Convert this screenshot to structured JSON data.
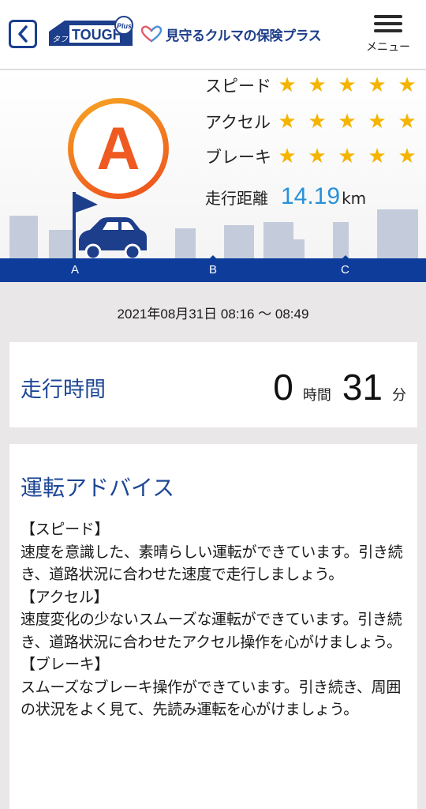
{
  "header": {
    "back_icon": "chevron-left-icon",
    "logo_small": "タフ",
    "logo_text": "TOUGH",
    "logo_badge": "Plus",
    "tagline": "見守るクルマの保険プラス",
    "menu_label": "メニュー"
  },
  "score": {
    "grade": "A",
    "ratings": [
      {
        "label": "スピード",
        "stars": 5
      },
      {
        "label": "アクセル",
        "stars": 5
      },
      {
        "label": "ブレーキ",
        "stars": 5
      }
    ],
    "distance_label": "走行距離",
    "distance_value": "14.19",
    "distance_unit": "km",
    "road_labels": [
      "A",
      "B",
      "C"
    ]
  },
  "trip": {
    "datetime": "2021年08月31日 08:16 〜 08:49"
  },
  "drive_time": {
    "title": "走行時間",
    "hours": "0",
    "hours_unit": "時間",
    "minutes": "31",
    "minutes_unit": "分"
  },
  "advice": {
    "title": "運転アドバイス",
    "sections": [
      {
        "heading": "【スピード】",
        "text": "速度を意識した、素晴らしい運転ができています。引き続き、道路状況に合わせた速度で走行しましょう。"
      },
      {
        "heading": "【アクセル】",
        "text": "速度変化の少ないスムーズな運転ができています。引き続き、道路状況に合わせたアクセル操作を心がけましょう。"
      },
      {
        "heading": "【ブレーキ】",
        "text": "スムーズなブレーキ操作ができています。引き続き、周囲の状況をよく見て、先読み運転を心がけましょう。"
      }
    ]
  },
  "colors": {
    "brand_blue": "#1d4796",
    "road_blue": "#0d3c9b",
    "grade_orange": "#ee5a22",
    "star_yellow": "#f4b400",
    "distance_blue": "#2891d8"
  }
}
